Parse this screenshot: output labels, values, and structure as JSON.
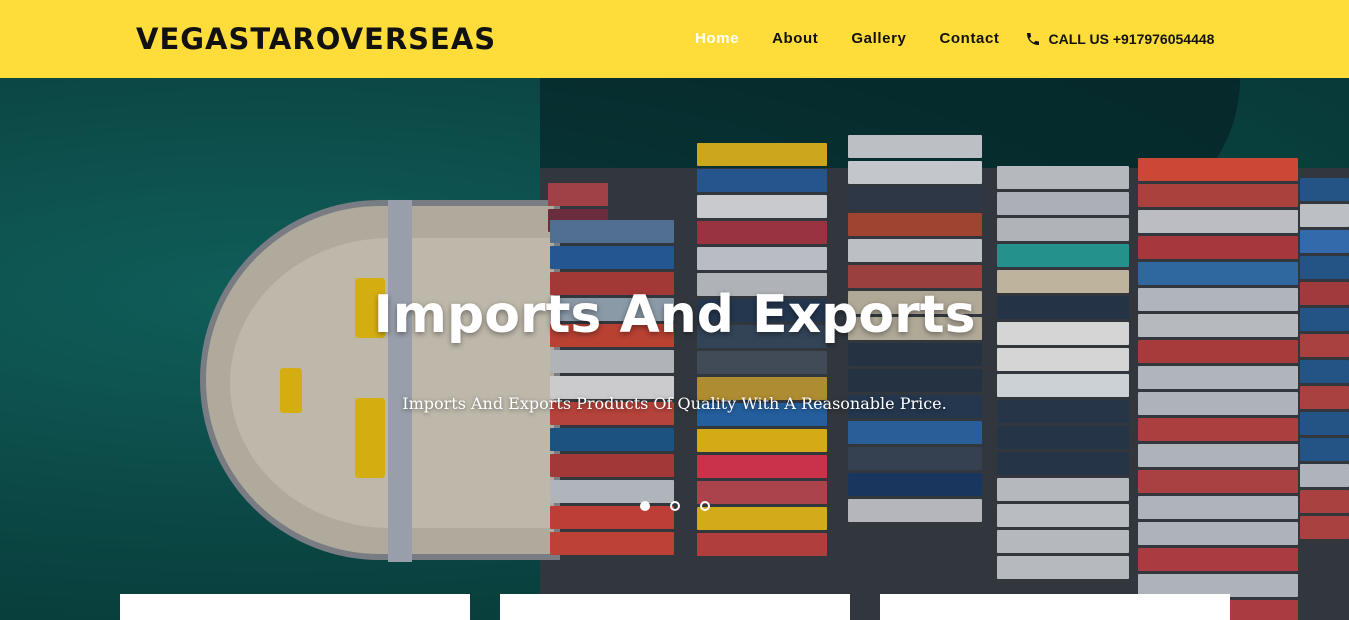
{
  "header": {
    "brand": "VEGASTAROVERSEAS",
    "nav": [
      {
        "label": "Home",
        "active": true
      },
      {
        "label": "About",
        "active": false
      },
      {
        "label": "Gallery",
        "active": false
      },
      {
        "label": "Contact",
        "active": false
      }
    ],
    "call_label": "CALL US +917976054448",
    "call_icon": "phone-icon"
  },
  "hero": {
    "title": "Imports And Exports",
    "subtitle": "Imports And Exports Products Of Quality With A Reasonable Price.",
    "slides_total": 3,
    "active_slide": 1
  },
  "colors": {
    "header_bg": "#fedd3a",
    "brand_text": "#111111",
    "active_nav": "#ffffff",
    "sea": "#0d4a48"
  }
}
